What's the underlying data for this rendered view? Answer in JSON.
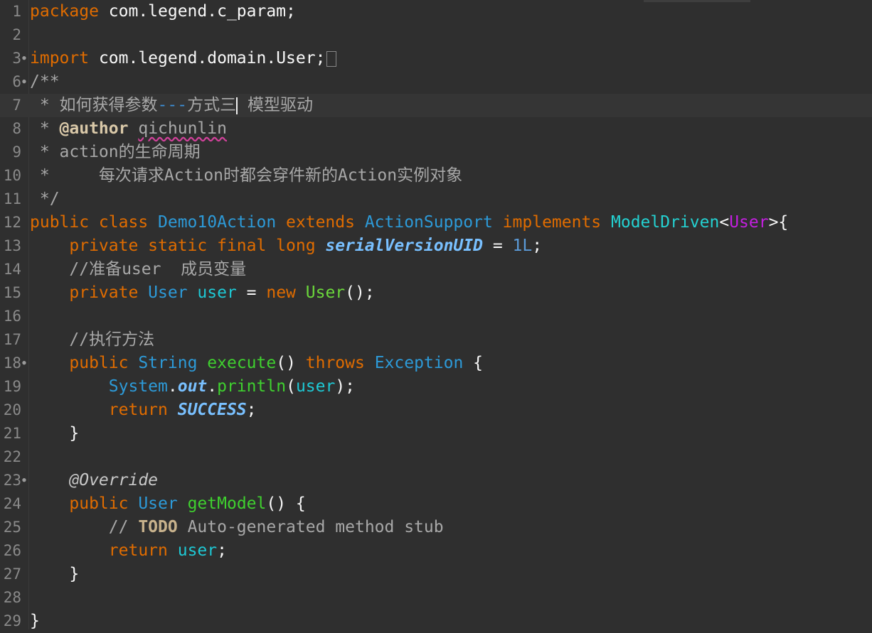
{
  "editor": {
    "lines": [
      {
        "n": "1",
        "tokens": [
          {
            "t": "package",
            "c": "kw"
          },
          {
            "t": " com.legend.c_param;",
            "c": ""
          }
        ]
      },
      {
        "n": "2",
        "tokens": []
      },
      {
        "n": "3",
        "fold": true,
        "tokens": [
          {
            "t": "import",
            "c": "kw"
          },
          {
            "t": " com.legend.domain.User;",
            "c": ""
          },
          {
            "folded": true
          }
        ]
      },
      {
        "n": "6",
        "fold": true,
        "tokens": [
          {
            "t": "/**",
            "c": "cm"
          }
        ]
      },
      {
        "n": "7",
        "current": true,
        "tokens": [
          {
            "t": " * 如何获得参数",
            "c": "cm"
          },
          {
            "t": "---",
            "c": "dash"
          },
          {
            "t": "方式三",
            "c": "cm"
          },
          {
            "caret": true
          },
          {
            "t": " 模型驱动",
            "c": "cm"
          }
        ]
      },
      {
        "n": "8",
        "tokens": [
          {
            "t": " * ",
            "c": "cm"
          },
          {
            "t": "@author",
            "c": "cmb"
          },
          {
            "t": " ",
            "c": "cm"
          },
          {
            "t": "qichunlin",
            "c": "cm wavy"
          }
        ]
      },
      {
        "n": "9",
        "tokens": [
          {
            "t": " * action的生命周期",
            "c": "cm"
          }
        ]
      },
      {
        "n": "10",
        "tokens": [
          {
            "t": " *     每次请求Action时都会穿件新的Action实例对象",
            "c": "cm"
          }
        ]
      },
      {
        "n": "11",
        "tokens": [
          {
            "t": " */",
            "c": "cm"
          }
        ]
      },
      {
        "n": "12",
        "tokens": [
          {
            "t": "public class ",
            "c": "kw"
          },
          {
            "t": "Demo10Action",
            "c": "ty"
          },
          {
            "t": " extends ",
            "c": "kw"
          },
          {
            "t": "ActionSupport",
            "c": "ty"
          },
          {
            "t": " implements ",
            "c": "kw"
          },
          {
            "t": "ModelDriven",
            "c": "cls"
          },
          {
            "t": "<",
            "c": ""
          },
          {
            "t": "User",
            "c": "pl"
          },
          {
            "t": ">{",
            "c": ""
          }
        ]
      },
      {
        "n": "13",
        "tokens": [
          {
            "t": "    private static final long ",
            "c": "kw"
          },
          {
            "t": "serialVersionUID",
            "c": "cst"
          },
          {
            "t": " = ",
            "c": ""
          },
          {
            "t": "1L",
            "c": "num"
          },
          {
            "t": ";",
            "c": ""
          }
        ]
      },
      {
        "n": "14",
        "tokens": [
          {
            "t": "    //准备user  成员变量",
            "c": "cm"
          }
        ]
      },
      {
        "n": "15",
        "tokens": [
          {
            "t": "    private ",
            "c": "kw"
          },
          {
            "t": "User",
            "c": "ty"
          },
          {
            "t": " ",
            "c": ""
          },
          {
            "t": "user",
            "c": "tm"
          },
          {
            "t": " = ",
            "c": ""
          },
          {
            "t": "new ",
            "c": "kw"
          },
          {
            "t": "User",
            "c": "gr"
          },
          {
            "t": "();",
            "c": ""
          }
        ]
      },
      {
        "n": "16",
        "tokens": []
      },
      {
        "n": "17",
        "tokens": [
          {
            "t": "    //执行方法",
            "c": "cm"
          }
        ]
      },
      {
        "n": "18",
        "fold": true,
        "tokens": [
          {
            "t": "    public ",
            "c": "kw"
          },
          {
            "t": "String",
            "c": "ty"
          },
          {
            "t": " ",
            "c": ""
          },
          {
            "t": "execute",
            "c": "fn"
          },
          {
            "t": "() ",
            "c": ""
          },
          {
            "t": "throws ",
            "c": "kw"
          },
          {
            "t": "Exception",
            "c": "ty"
          },
          {
            "t": " {",
            "c": ""
          }
        ]
      },
      {
        "n": "19",
        "tokens": [
          {
            "t": "        System",
            "c": "ty"
          },
          {
            "t": ".",
            "c": ""
          },
          {
            "t": "out",
            "c": "cst"
          },
          {
            "t": ".",
            "c": ""
          },
          {
            "t": "println",
            "c": "fn"
          },
          {
            "t": "(",
            "c": ""
          },
          {
            "t": "user",
            "c": "tm"
          },
          {
            "t": ");",
            "c": ""
          }
        ]
      },
      {
        "n": "20",
        "tokens": [
          {
            "t": "        return ",
            "c": "kw"
          },
          {
            "t": "SUCCESS",
            "c": "cst"
          },
          {
            "t": ";",
            "c": ""
          }
        ]
      },
      {
        "n": "21",
        "tokens": [
          {
            "t": "    }",
            "c": ""
          }
        ]
      },
      {
        "n": "22",
        "tokens": []
      },
      {
        "n": "23",
        "fold": true,
        "tokens": [
          {
            "t": "    @Override",
            "c": "ann"
          }
        ]
      },
      {
        "n": "24",
        "tokens": [
          {
            "t": "    public ",
            "c": "kw"
          },
          {
            "t": "User",
            "c": "ty"
          },
          {
            "t": " ",
            "c": ""
          },
          {
            "t": "getModel",
            "c": "fn"
          },
          {
            "t": "() {",
            "c": ""
          }
        ]
      },
      {
        "n": "25",
        "tokens": [
          {
            "t": "        // ",
            "c": "cm"
          },
          {
            "t": "TODO",
            "c": "todo"
          },
          {
            "t": " Auto-generated method stub",
            "c": "cm"
          }
        ]
      },
      {
        "n": "26",
        "tokens": [
          {
            "t": "        return ",
            "c": "kw"
          },
          {
            "t": "user",
            "c": "tm"
          },
          {
            "t": ";",
            "c": ""
          }
        ]
      },
      {
        "n": "27",
        "tokens": [
          {
            "t": "    }",
            "c": ""
          }
        ]
      },
      {
        "n": "28",
        "tokens": []
      },
      {
        "n": "29",
        "tokens": [
          {
            "t": "}",
            "c": ""
          }
        ]
      }
    ]
  }
}
